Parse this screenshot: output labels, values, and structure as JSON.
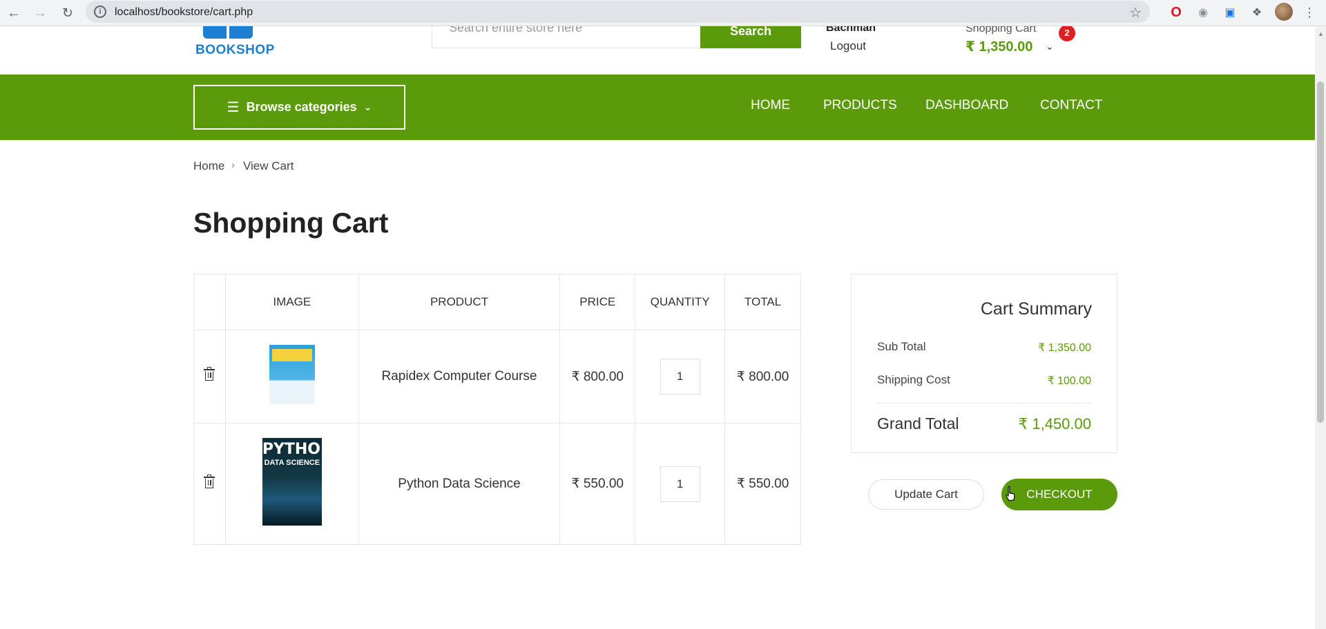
{
  "browser": {
    "url": "localhost/bookstore/cart.php"
  },
  "header": {
    "logo_text": "BOOKSHOP",
    "search_placeholder": "Search entire store here",
    "search_button": "Search",
    "user_name": "Bachman",
    "logout": "Logout",
    "cart_label": "Shopping Cart",
    "cart_count": "2",
    "cart_amount": "₹ 1,350.00"
  },
  "nav": {
    "browse_label": "Browse categories",
    "items": [
      "HOME",
      "PRODUCTS",
      "DASHBOARD",
      "CONTACT"
    ]
  },
  "breadcrumb": {
    "home": "Home",
    "current": "View Cart"
  },
  "page_title": "Shopping Cart",
  "table": {
    "headers": [
      "",
      "IMAGE",
      "PRODUCT",
      "PRICE",
      "QUANTITY",
      "TOTAL"
    ],
    "rows": [
      {
        "product": "Rapidex Computer Course",
        "price": "₹ 800.00",
        "quantity": "1",
        "total": "₹ 800.00"
      },
      {
        "product": "Python Data Science",
        "price": "₹ 550.00",
        "quantity": "1",
        "total": "₹ 550.00",
        "cover_title": "PYTHON",
        "cover_subtitle": "DATA SCIENCE"
      }
    ]
  },
  "summary": {
    "title": "Cart Summary",
    "sub_total_label": "Sub Total",
    "sub_total": "₹ 1,350.00",
    "shipping_label": "Shipping Cost",
    "shipping": "₹ 100.00",
    "grand_total_label": "Grand Total",
    "grand_total": "₹ 1,450.00"
  },
  "actions": {
    "update": "Update Cart",
    "checkout": "CHECKOUT"
  },
  "colors": {
    "brand_green": "#5b9a0a",
    "logo_blue": "#1e7fd0",
    "badge_red": "#e02020"
  }
}
